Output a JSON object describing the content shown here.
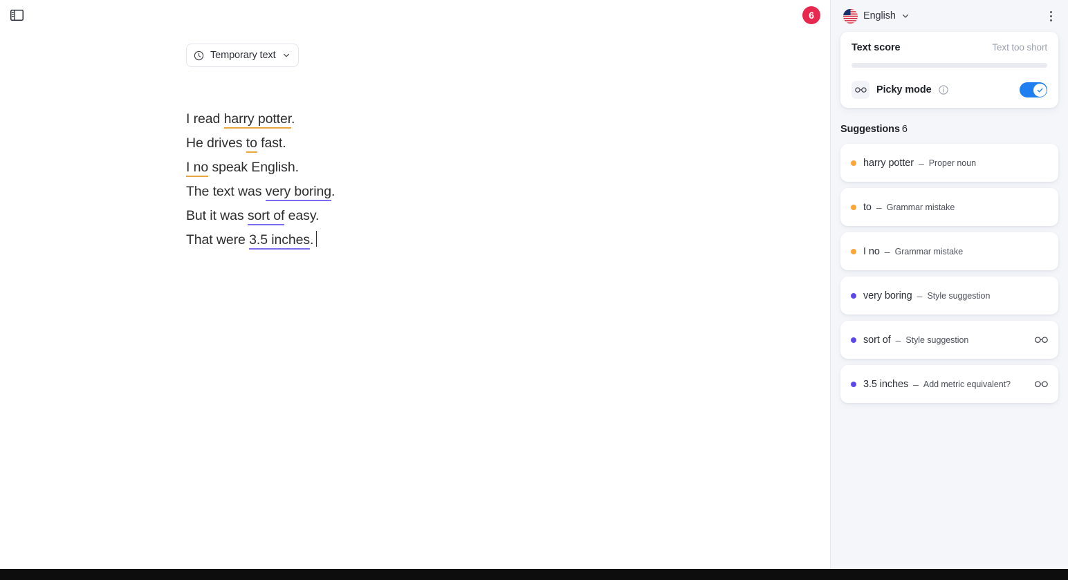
{
  "editor": {
    "panel_toggle_icon": "sidebar-panel-icon",
    "doc_type": {
      "icon": "clock-icon",
      "label": "Temporary text",
      "chevron": "chevron-down-icon"
    },
    "lines": [
      {
        "pre": "I read ",
        "mark": "harry potter",
        "mark_style": "orange",
        "post": "."
      },
      {
        "pre": "He drives ",
        "mark": "to",
        "mark_style": "orange",
        "post": " fast."
      },
      {
        "pre": "",
        "mark": "I no",
        "mark_style": "orange",
        "post": " speak English."
      },
      {
        "pre": "The text was ",
        "mark": "very boring",
        "mark_style": "purple",
        "post": "."
      },
      {
        "pre": "But it was ",
        "mark": "sort of",
        "mark_style": "purple",
        "post": " easy."
      },
      {
        "pre": "That were ",
        "mark": "3.5 inches",
        "mark_style": "purple",
        "post": ".",
        "caret": true
      }
    ]
  },
  "sidebar": {
    "badge": "6",
    "language": {
      "flag": "us-flag-icon",
      "label": "English",
      "chevron": "chevron-down-icon"
    },
    "menu_icon": "kebab-menu-icon",
    "score": {
      "title": "Text score",
      "status": "Text too short",
      "progress_percent": 0,
      "picky": {
        "icon": "glasses-icon",
        "label": "Picky mode",
        "info_icon": "info-icon",
        "toggle_on": true
      }
    },
    "suggestions_header": {
      "label": "Suggestions",
      "count": "6"
    },
    "suggestions": [
      {
        "text": "harry potter",
        "dash": "–",
        "kind": "Proper noun",
        "color": "#f9a53c",
        "has_glasses": false
      },
      {
        "text": "to",
        "dash": "–",
        "kind": "Grammar mistake",
        "color": "#f9a53c",
        "has_glasses": false
      },
      {
        "text": "I no",
        "dash": "–",
        "kind": "Grammar mistake",
        "color": "#f9a53c",
        "has_glasses": false
      },
      {
        "text": "very boring",
        "dash": "–",
        "kind": "Style suggestion",
        "color": "#5b4ae8",
        "has_glasses": false
      },
      {
        "text": "sort of",
        "dash": "–",
        "kind": "Style suggestion",
        "color": "#5b4ae8",
        "has_glasses": true
      },
      {
        "text": "3.5 inches",
        "dash": "–",
        "kind": "Add metric equivalent?",
        "color": "#5b4ae8",
        "has_glasses": true
      }
    ]
  },
  "colors": {
    "accent_blue": "#1f7ef0",
    "badge_red": "#e8294f",
    "orange": "#f9a53c",
    "purple": "#5b4ae8",
    "sidebar_bg": "#f4f6fa"
  }
}
